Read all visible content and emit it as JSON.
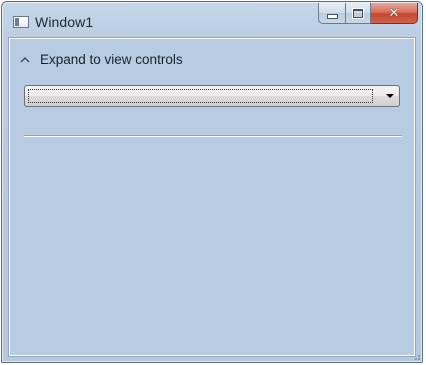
{
  "window": {
    "title": "Window1",
    "icon": "application-window-icon",
    "caption_buttons": {
      "minimize": "minimize-icon",
      "maximize": "maximize-icon",
      "close": "close-icon"
    }
  },
  "expander": {
    "header": "Expand to view controls",
    "icon": "chevron-up-icon",
    "expanded": true
  },
  "combo_box": {
    "selected_value": "",
    "icon": "dropdown-arrow-icon"
  },
  "colors": {
    "window_frame": "#b9cde3",
    "client_background": "#b7cce2",
    "close_button": "#c4472f"
  }
}
